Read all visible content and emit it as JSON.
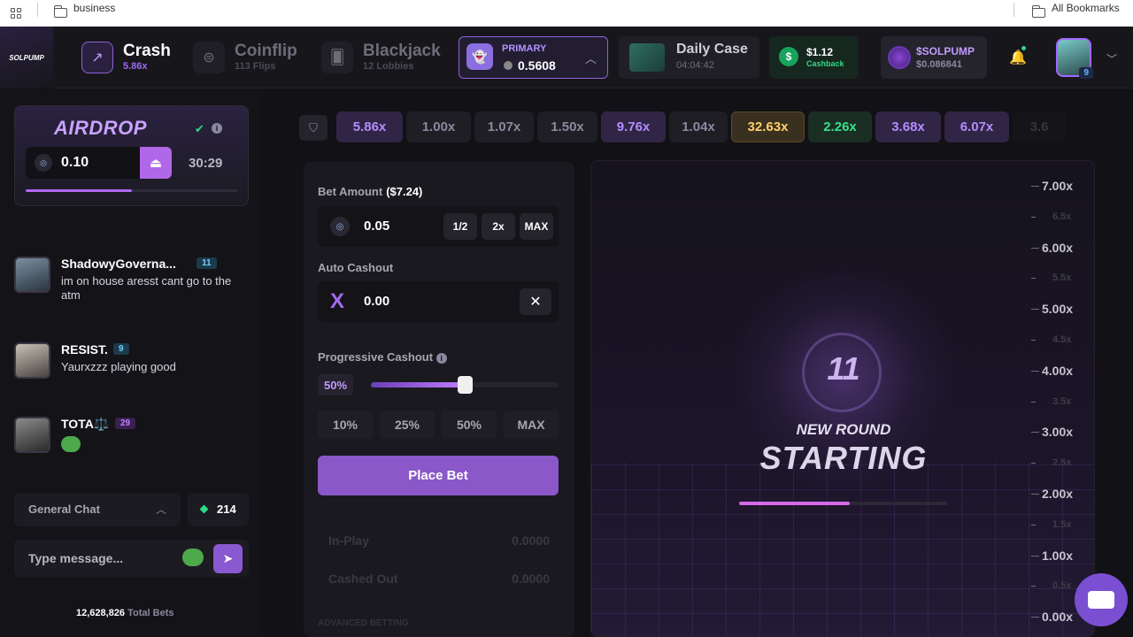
{
  "bookmarks": {
    "folder": "business",
    "all": "All Bookmarks"
  },
  "brand": "SOLPUMP",
  "nav": {
    "games": [
      {
        "name": "Crash",
        "sub": "5.86x",
        "active": true
      },
      {
        "name": "Coinflip",
        "sub": "113 Flips",
        "active": false
      },
      {
        "name": "Blackjack",
        "sub": "12 Lobbies",
        "active": false
      }
    ],
    "wallet": {
      "label": "PRIMARY",
      "value": "0.5608"
    },
    "daily_case": {
      "title": "Daily Case",
      "timer": "04:04:42"
    },
    "cashback": {
      "value": "$1.12",
      "label": "Cashback"
    },
    "solpump": {
      "label": "$SOLPUMP",
      "value": "$0.086841"
    },
    "user_level": "9"
  },
  "airdrop": {
    "title": "AIRDROP",
    "amount": "0.10",
    "timer": "30:29",
    "progress": 0.5
  },
  "chat": {
    "messages": [
      {
        "user": "ShadowyGoverna...",
        "level": "11",
        "text": "im on house aresst cant go to the atm"
      },
      {
        "user": "RESIST.",
        "level": "9",
        "text": "Yaurxzzz playing good"
      },
      {
        "user": "TOTA⚖️",
        "level": "29",
        "text": ""
      }
    ],
    "room": "General Chat",
    "online": "214",
    "placeholder": "Type message...",
    "total_bets": "12,628,826",
    "total_label": "Total Bets"
  },
  "multipliers": [
    {
      "v": "5.86x",
      "c": "purple"
    },
    {
      "v": "1.00x",
      "c": "gray"
    },
    {
      "v": "1.07x",
      "c": "gray"
    },
    {
      "v": "1.50x",
      "c": "gray"
    },
    {
      "v": "9.76x",
      "c": "purple"
    },
    {
      "v": "1.04x",
      "c": "gray"
    },
    {
      "v": "32.63x",
      "c": "gold"
    },
    {
      "v": "2.26x",
      "c": "green"
    },
    {
      "v": "3.68x",
      "c": "purple"
    },
    {
      "v": "6.07x",
      "c": "purple"
    },
    {
      "v": "3.6",
      "c": "gray"
    }
  ],
  "bet": {
    "amount_label": "Bet Amount",
    "amount_usd": "($7.24)",
    "amount": "0.05",
    "half": "1/2",
    "double": "2x",
    "max": "MAX",
    "auto_label": "Auto Cashout",
    "auto_value": "0.00",
    "prog_label": "Progressive Cashout",
    "prog_value": "50%",
    "prog_fraction": 0.5,
    "quick": [
      "10%",
      "25%",
      "50%",
      "MAX"
    ],
    "place": "Place Bet",
    "in_play": "In-Play",
    "in_play_value": "0.0000",
    "cashed_out": "Cashed Out",
    "cashed_out_value": "0.0000",
    "advanced": "ADVANCED BETTING"
  },
  "round": {
    "countdown": "11",
    "line1": "NEW ROUND",
    "line2": "STARTING",
    "progress": 0.53
  },
  "axis_labels": [
    {
      "v": "7.00x",
      "major": true
    },
    {
      "v": "6.5x",
      "major": false
    },
    {
      "v": "6.00x",
      "major": true
    },
    {
      "v": "5.5x",
      "major": false
    },
    {
      "v": "5.00x",
      "major": true
    },
    {
      "v": "4.5x",
      "major": false
    },
    {
      "v": "4.00x",
      "major": true
    },
    {
      "v": "3.5x",
      "major": false
    },
    {
      "v": "3.00x",
      "major": true
    },
    {
      "v": "2.5x",
      "major": false
    },
    {
      "v": "2.00x",
      "major": true
    },
    {
      "v": "1.5x",
      "major": false
    },
    {
      "v": "1.00x",
      "major": true
    },
    {
      "v": "0.5x",
      "major": false
    },
    {
      "v": "0.00x",
      "major": true
    }
  ]
}
